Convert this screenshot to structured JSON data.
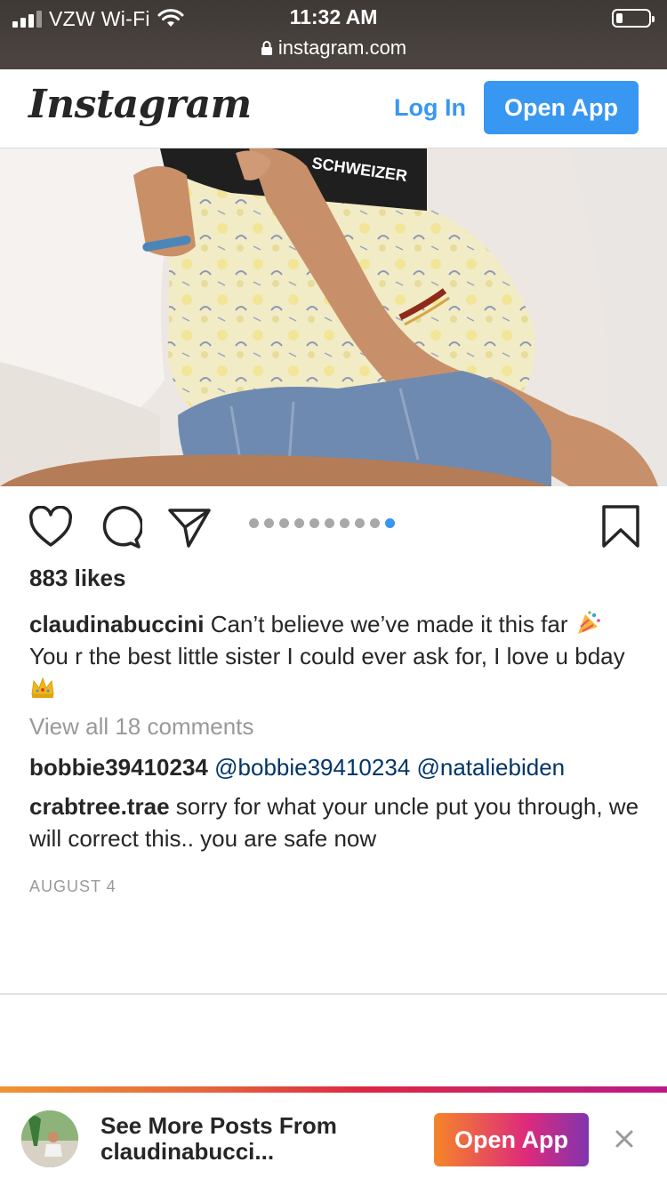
{
  "status_bar": {
    "carrier": "VZW Wi-Fi",
    "time": "11:32 AM",
    "url": "instagram.com",
    "battery_level": 0.2
  },
  "header": {
    "logo": "Instagram",
    "login_label": "Log In",
    "open_app_label": "Open App"
  },
  "post": {
    "photo_icon": "post-photo",
    "carousel": {
      "total": 10,
      "active_index": 9
    },
    "likes": "883 likes",
    "caption": {
      "username": "claudinabuccini",
      "text_part1": "Can’t believe we’ve made it this far",
      "text_part2": "You r the best little sister I could ever ask for, I love u bday"
    },
    "view_all_comments": "View all 18 comments",
    "comments": [
      {
        "username": "bobbie39410234",
        "text": "@bobbie39410234 @nataliebiden"
      },
      {
        "username": "crabtree.trae",
        "text": "sorry for what your uncle put you through, we will correct this.. you are safe now"
      }
    ],
    "date": "AUGUST 4"
  },
  "banner": {
    "text_line1": "See More Posts From",
    "text_line2": "claudinabucci...",
    "open_app_label": "Open App",
    "close_icon": "close-icon",
    "accent_gradient": [
      "#f58529",
      "#dd2a7b",
      "#8134af"
    ]
  },
  "colors": {
    "link_blue": "#3897f0",
    "mention": "#003569",
    "muted": "#999999"
  }
}
